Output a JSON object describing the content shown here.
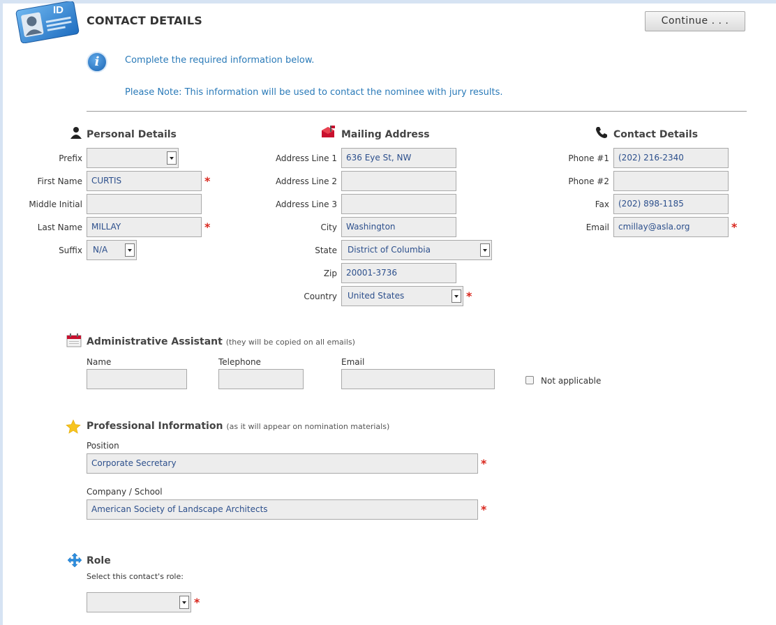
{
  "header": {
    "logo_text": "ID",
    "title": "CONTACT DETAILS",
    "continue_label": "Continue . . ."
  },
  "notice": {
    "line1": "Complete the required information below.",
    "line2": "Please Note: This information will be used to contact the nominee with jury results."
  },
  "personal": {
    "heading": "Personal Details",
    "prefix_label": "Prefix",
    "prefix_value": "",
    "first_name_label": "First Name",
    "first_name_value": "CURTIS",
    "middle_initial_label": "Middle Initial",
    "middle_initial_value": "",
    "last_name_label": "Last Name",
    "last_name_value": "MILLAY",
    "suffix_label": "Suffix",
    "suffix_value": "N/A"
  },
  "mailing": {
    "heading": "Mailing Address",
    "address1_label": "Address Line 1",
    "address1_value": "636 Eye St, NW",
    "address2_label": "Address Line 2",
    "address2_value": "",
    "address3_label": "Address Line 3",
    "address3_value": "",
    "city_label": "City",
    "city_value": "Washington",
    "state_label": "State",
    "state_value": "District of Columbia",
    "zip_label": "Zip",
    "zip_value": "20001-3736",
    "country_label": "Country",
    "country_value": "United States"
  },
  "contact": {
    "heading": "Contact Details",
    "phone1_label": "Phone #1",
    "phone1_value": "(202) 216-2340",
    "phone2_label": "Phone #2",
    "phone2_value": "",
    "fax_label": "Fax",
    "fax_value": "(202) 898-1185",
    "email_label": "Email",
    "email_value": "cmillay@asla.org"
  },
  "assistant": {
    "heading": "Administrative Assistant",
    "subheading": "(they will be copied on all emails)",
    "name_label": "Name",
    "name_value": "",
    "telephone_label": "Telephone",
    "telephone_value": "",
    "email_label": "Email",
    "email_value": "",
    "not_applicable_label": "Not applicable"
  },
  "professional": {
    "heading": "Professional Information",
    "subheading": "(as it will appear on nomination materials)",
    "position_label": "Position",
    "position_value": "Corporate Secretary",
    "company_label": "Company / School",
    "company_value": "American Society of Landscape Architects"
  },
  "role": {
    "heading": "Role",
    "prompt": "Select this contact's role:",
    "value": ""
  },
  "required_mark": "*"
}
